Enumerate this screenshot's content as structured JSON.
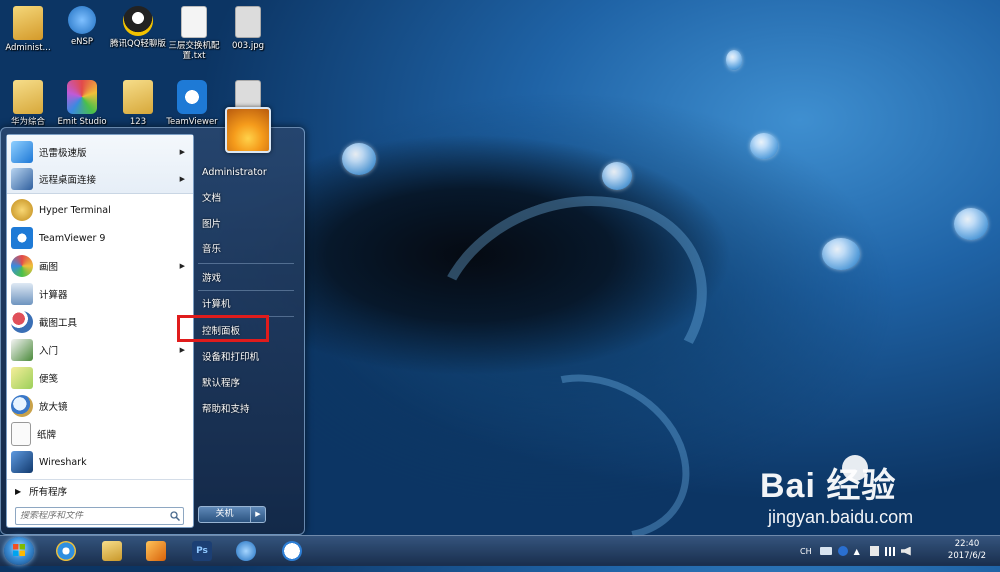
{
  "desktop": {
    "icons": [
      {
        "label": "Administ...",
        "icon": "user-folder-icon",
        "color": "#e8b84a"
      },
      {
        "label": "eNSP",
        "icon": "ensp-icon",
        "color": "#2a7fd0"
      },
      {
        "label": "腾讯QQ轻聊版",
        "icon": "qq-icon",
        "color": "#222222"
      },
      {
        "label": "三层交换机配置.txt",
        "icon": "text-file-icon",
        "color": "#f2f2f2"
      },
      {
        "label": "003.jpg",
        "icon": "image-file-icon",
        "color": "#d8d8d8"
      },
      {
        "label": "华为综合",
        "icon": "folder-icon",
        "color": "#e8c35a"
      },
      {
        "label": "Emit Studio",
        "icon": "emit-studio-icon",
        "color": "#c05ad8"
      },
      {
        "label": "123",
        "icon": "folder-icon",
        "color": "#e8c35a"
      },
      {
        "label": "TeamViewer",
        "icon": "teamviewer-icon",
        "color": "#1e7ad6"
      },
      {
        "label": "",
        "icon": "file-icon",
        "color": "#d8d8d8"
      }
    ]
  },
  "start_menu": {
    "pinned": [
      {
        "label": "迅雷极速版",
        "icon": "thunder-icon",
        "color": "#2e8ee6",
        "has_submenu": true
      },
      {
        "label": "远程桌面连接",
        "icon": "remote-desktop-icon",
        "color": "#3a6fb5",
        "has_submenu": true
      }
    ],
    "programs": [
      {
        "label": "Hyper Terminal",
        "icon": "hyper-terminal-icon",
        "color": "#d4a42c",
        "has_submenu": false
      },
      {
        "label": "TeamViewer 9",
        "icon": "teamviewer-icon",
        "color": "#1e7ad6",
        "has_submenu": false
      },
      {
        "label": "画图",
        "icon": "paint-icon",
        "color": "#e07a3a",
        "has_submenu": true
      },
      {
        "label": "计算器",
        "icon": "calculator-icon",
        "color": "#5e88b8",
        "has_submenu": false
      },
      {
        "label": "截图工具",
        "icon": "snipping-tool-icon",
        "color": "#c0392b",
        "has_submenu": false
      },
      {
        "label": "入门",
        "icon": "getting-started-icon",
        "color": "#4a8a3a",
        "has_submenu": true
      },
      {
        "label": "便笺",
        "icon": "sticky-notes-icon",
        "color": "#d8c83a",
        "has_submenu": false
      },
      {
        "label": "放大镜",
        "icon": "magnifier-icon",
        "color": "#3a78c8",
        "has_submenu": false
      },
      {
        "label": "纸牌",
        "icon": "solitaire-icon",
        "color": "#e8e8e8",
        "has_submenu": false
      },
      {
        "label": "Wireshark",
        "icon": "wireshark-icon",
        "color": "#1d5da8",
        "has_submenu": false
      }
    ],
    "all_programs_label": "所有程序",
    "search_placeholder": "搜索程序和文件",
    "right_pane": [
      {
        "label": "Administrator"
      },
      {
        "label": "文档"
      },
      {
        "label": "图片"
      },
      {
        "label": "音乐"
      },
      {
        "label": "游戏"
      },
      {
        "label": "计算机"
      },
      {
        "label": "控制面板"
      },
      {
        "label": "设备和打印机"
      },
      {
        "label": "默认程序"
      },
      {
        "label": "帮助和支持"
      }
    ],
    "shutdown_label": "关机",
    "highlight_color": "#e01c1c"
  },
  "taskbar": {
    "pinned": [
      {
        "icon": "internet-explorer-icon",
        "color": "#2f8fe0"
      },
      {
        "icon": "file-explorer-icon",
        "color": "#e2c04a"
      },
      {
        "icon": "media-player-icon",
        "color": "#f08a1a"
      },
      {
        "icon": "photoshop-icon",
        "color": "#1c3f74"
      },
      {
        "icon": "ensp-icon",
        "color": "#2a7fd0"
      },
      {
        "icon": "sogou-icon",
        "color": "#ffffff"
      }
    ],
    "tray_lang": "CH",
    "clock_time": "22:40",
    "clock_date": "2017/6/2"
  },
  "watermark": {
    "brand": "Bai 经验",
    "url": "jingyan.baidu.com"
  }
}
